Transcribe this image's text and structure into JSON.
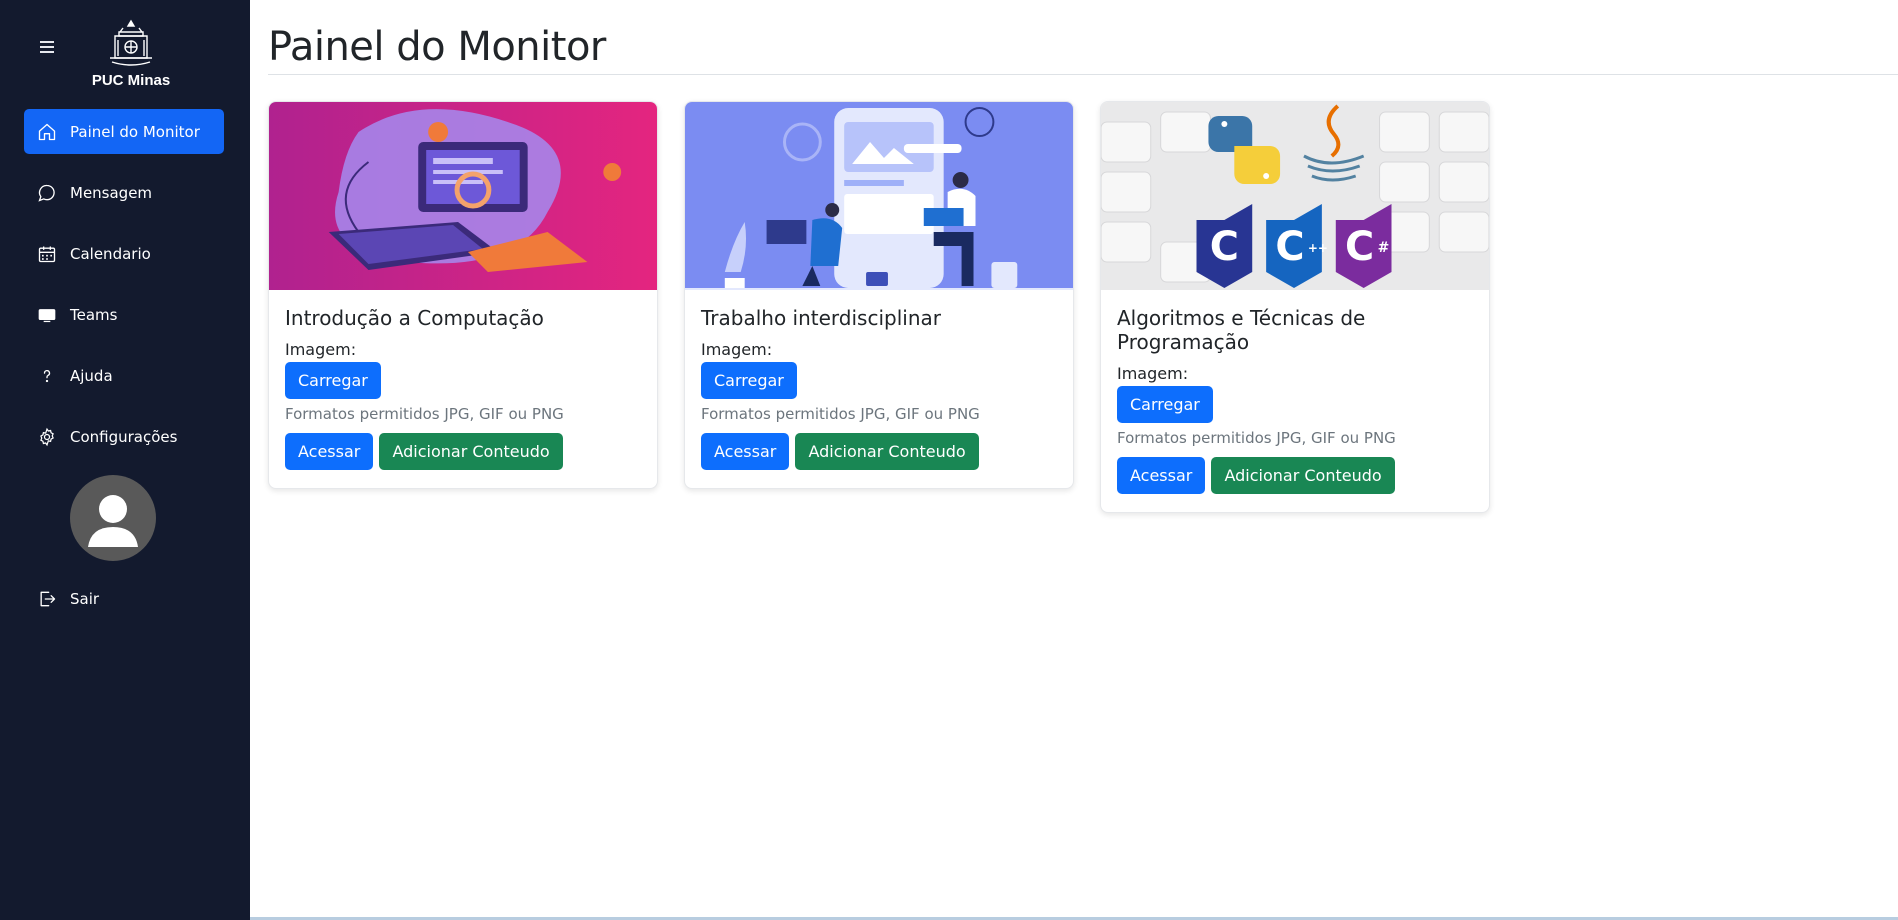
{
  "sidebar": {
    "logo_text": "PUC Minas",
    "items": [
      {
        "label": "Painel do Monitor",
        "icon": "home-icon",
        "active": true
      },
      {
        "label": "Mensagem",
        "icon": "chat-icon",
        "active": false
      },
      {
        "label": "Calendario",
        "icon": "calendar-icon",
        "active": false
      },
      {
        "label": "Teams",
        "icon": "monitor-icon",
        "active": false
      },
      {
        "label": "Ajuda",
        "icon": "help-icon",
        "active": false
      },
      {
        "label": "Configurações",
        "icon": "gear-icon",
        "active": false
      }
    ],
    "logout_label": "Sair"
  },
  "main": {
    "title": "Painel do Monitor",
    "cards": [
      {
        "title": "Introdução a Computação",
        "image_label": "Imagem:",
        "upload_label": "Carregar",
        "formats_hint": "Formatos permitidos JPG, GIF ou PNG",
        "access_label": "Acessar",
        "add_label": "Adicionar Conteudo"
      },
      {
        "title": "Trabalho interdisciplinar",
        "image_label": "Imagem:",
        "upload_label": "Carregar",
        "formats_hint": "Formatos permitidos JPG, GIF ou PNG",
        "access_label": "Acessar",
        "add_label": "Adicionar Conteudo"
      },
      {
        "title": "Algoritmos e Técnicas de Programação",
        "image_label": "Imagem:",
        "upload_label": "Carregar",
        "formats_hint": "Formatos permitidos JPG, GIF ou PNG",
        "access_label": "Acessar",
        "add_label": "Adicionar Conteudo"
      }
    ]
  },
  "colors": {
    "sidebar_bg": "#131a2e",
    "active_item": "#1366f5",
    "primary_button": "#0d6efd",
    "success_button": "#198754"
  }
}
